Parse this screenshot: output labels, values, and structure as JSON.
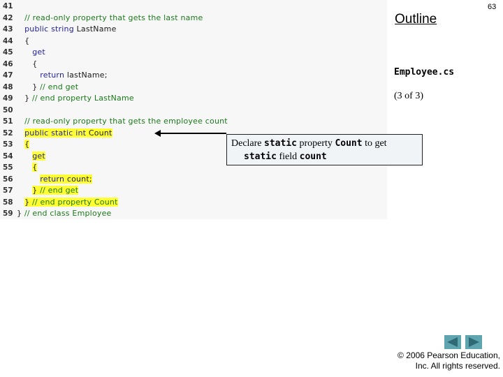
{
  "slide": {
    "page_number": "63",
    "outline_title": "Outline",
    "file_name": "Employee.cs",
    "page_of": "(3 of 3)",
    "copyright_line1": "© 2006 Pearson Education,",
    "copyright_line2": "Inc.  All rights reserved.",
    "nav": {
      "prev_icon": "triangle-left-icon",
      "next_icon": "triangle-right-icon"
    },
    "colors": {
      "code_background": "#f7f7f7",
      "highlight": "#ffff33",
      "comment": "#1a7a1a",
      "keyword": "#1f1fa0",
      "nav_button": "#5fa5b0",
      "callout_background": "#f0f4f6"
    }
  },
  "code": {
    "lines": [
      {
        "num": "41",
        "text": "",
        "type": "plain",
        "highlight": false
      },
      {
        "num": "42",
        "text": "   // read-only property that gets the last name",
        "type": "comment",
        "highlight": false
      },
      {
        "num": "43",
        "text": "   public string LastName",
        "type": "keyword",
        "highlight": false
      },
      {
        "num": "44",
        "text": "   {",
        "type": "plain",
        "highlight": false
      },
      {
        "num": "45",
        "text": "      get",
        "type": "keyword",
        "highlight": false
      },
      {
        "num": "46",
        "text": "      {",
        "type": "plain",
        "highlight": false
      },
      {
        "num": "47",
        "text": "         return lastName;",
        "type": "keyword",
        "highlight": false
      },
      {
        "num": "48",
        "text": "      } // end get",
        "type": "comment",
        "highlight": false
      },
      {
        "num": "49",
        "text": "   } // end property LastName",
        "type": "comment",
        "highlight": false
      },
      {
        "num": "50",
        "text": "",
        "type": "plain",
        "highlight": false
      },
      {
        "num": "51",
        "text": "   // read-only property that gets the employee count",
        "type": "comment",
        "highlight": false
      },
      {
        "num": "52",
        "text": "   public static int Count",
        "type": "keyword",
        "highlight": true
      },
      {
        "num": "53",
        "text": "   {",
        "type": "plain",
        "highlight": true
      },
      {
        "num": "54",
        "text": "      get",
        "type": "keyword",
        "highlight": true
      },
      {
        "num": "55",
        "text": "      {",
        "type": "plain",
        "highlight": true
      },
      {
        "num": "56",
        "text": "         return count;",
        "type": "keyword",
        "highlight": true
      },
      {
        "num": "57",
        "text": "      } // end get",
        "type": "comment",
        "highlight": true
      },
      {
        "num": "58",
        "text": "   } // end property Count",
        "type": "comment",
        "highlight": true
      },
      {
        "num": "59",
        "text": "} // end class Employee",
        "type": "comment",
        "highlight": false
      }
    ]
  },
  "callout": {
    "part1": "Declare ",
    "part2": "static",
    "part3": " property ",
    "part4": "Count",
    "part5": " to get",
    "part6": "static",
    "part7": " field ",
    "part8": "count"
  }
}
